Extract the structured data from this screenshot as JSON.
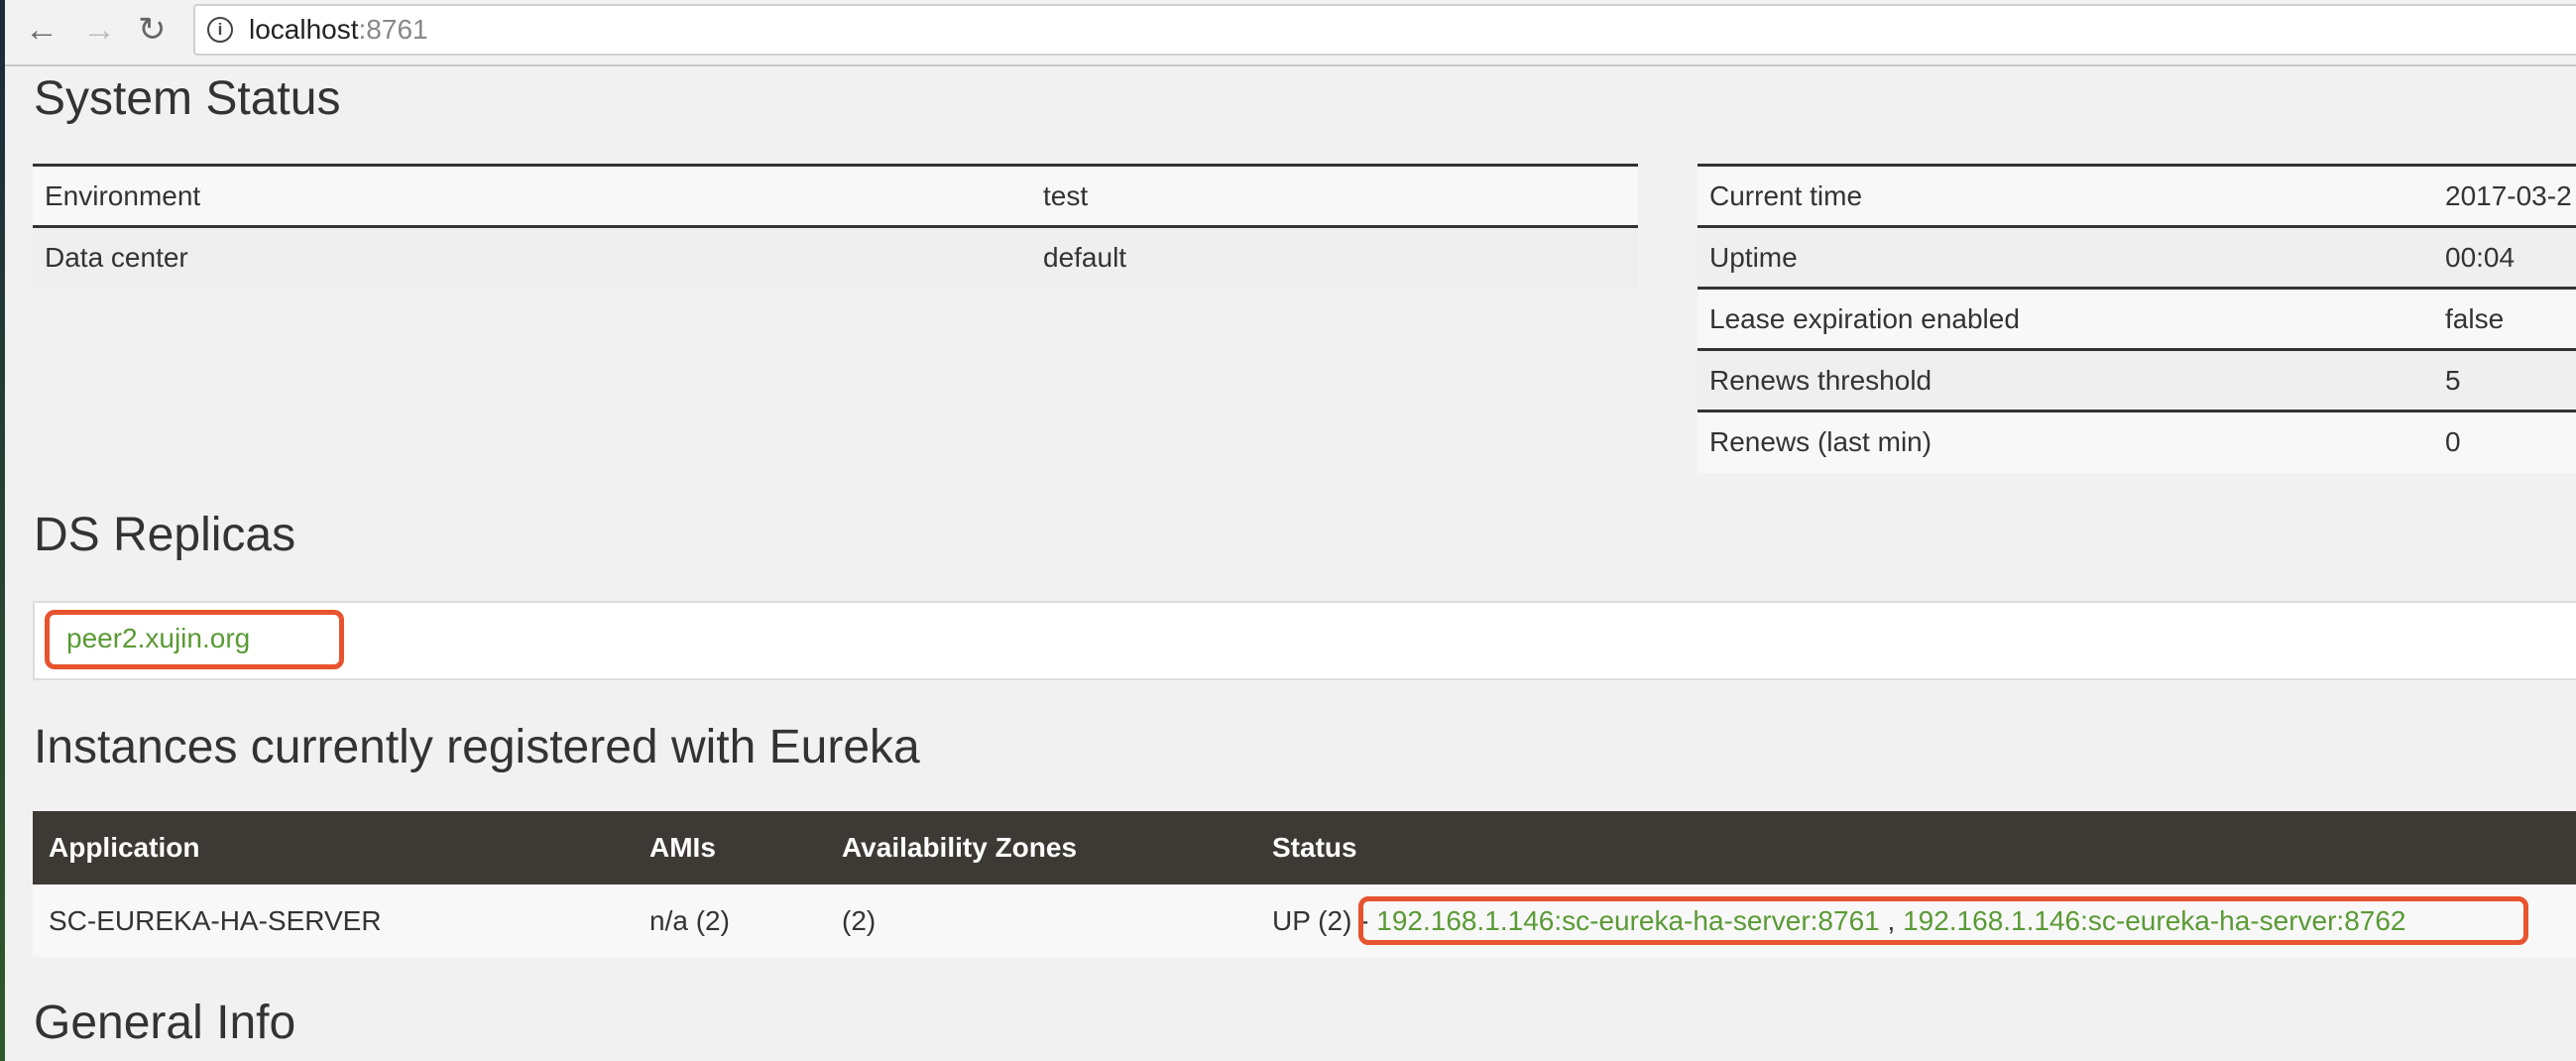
{
  "browser": {
    "host": "localhost",
    "port": ":8761"
  },
  "system_status": {
    "title": "System Status",
    "left": [
      {
        "k": "Environment",
        "v": "test"
      },
      {
        "k": "Data center",
        "v": "default"
      }
    ],
    "right": [
      {
        "k": "Current time",
        "v": "2017-03-2"
      },
      {
        "k": "Uptime",
        "v": "00:04"
      },
      {
        "k": "Lease expiration enabled",
        "v": "false"
      },
      {
        "k": "Renews threshold",
        "v": "5"
      },
      {
        "k": "Renews (last min)",
        "v": "0"
      }
    ]
  },
  "replicas": {
    "title": "DS Replicas",
    "peer": "peer2.xujin.org"
  },
  "instances": {
    "title": "Instances currently registered with Eureka",
    "headers": [
      "Application",
      "AMIs",
      "Availability Zones",
      "Status"
    ],
    "row": {
      "app": "SC-EUREKA-HA-SERVER",
      "amis": "n/a (2)",
      "zones": "(2)",
      "status": "UP (2)",
      "sep": " - ",
      "link1": "192.168.1.146:sc-eureka-ha-server:8761",
      "comma": " , ",
      "link2": "192.168.1.146:sc-eureka-ha-server:8762"
    }
  },
  "general": {
    "title": "General Info"
  }
}
